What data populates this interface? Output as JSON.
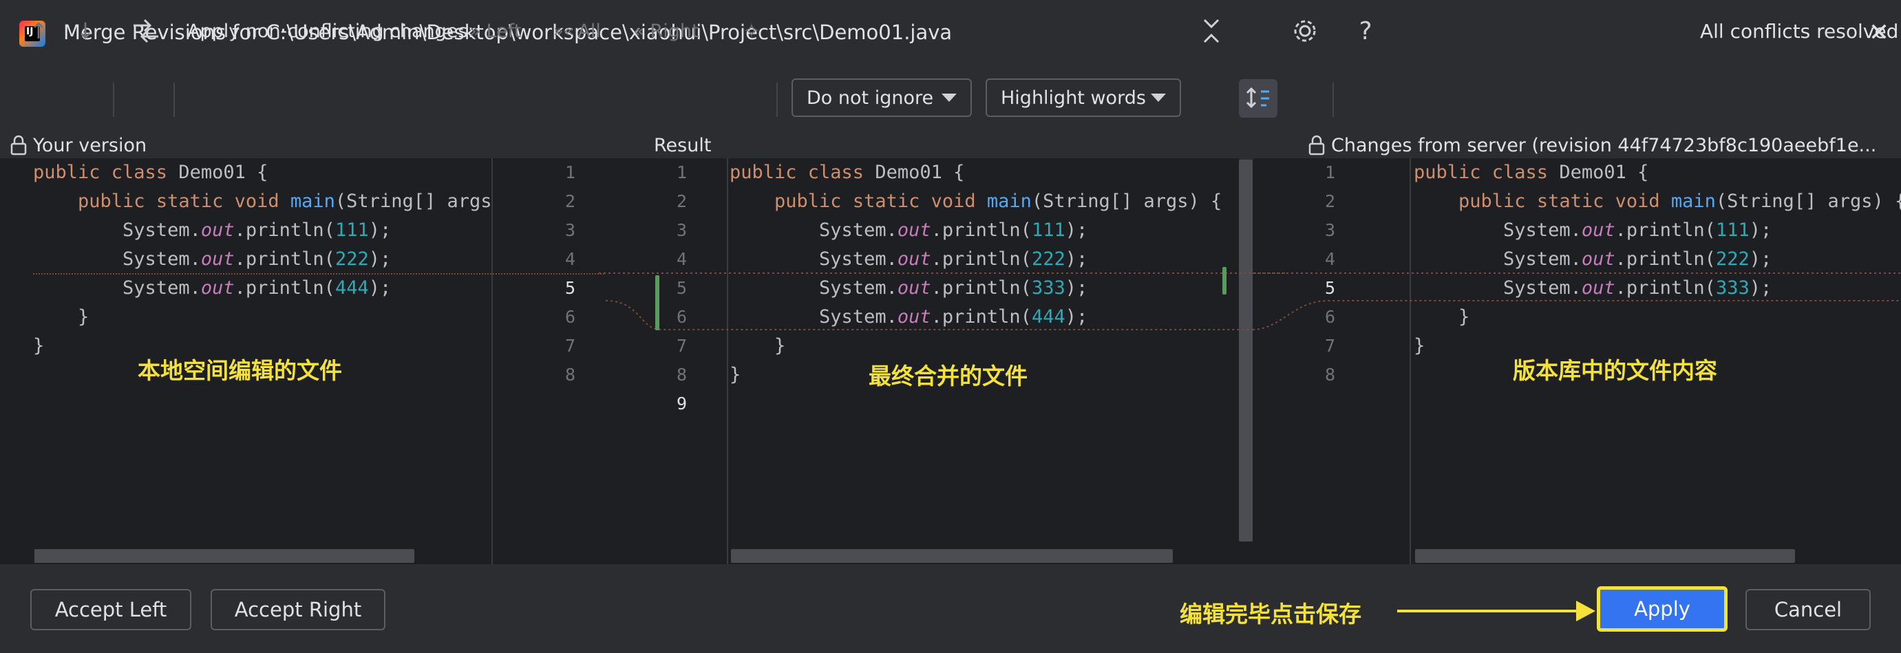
{
  "window": {
    "title": "Merge Revisions for C:\\Users\\Admin\\Desktop\\workspace\\xiaohui\\Project\\src\\Demo01.java",
    "app_icon_text": "IJ"
  },
  "toolbar": {
    "apply_label": "Apply non-conflicting changes:",
    "left_label": "Left",
    "all_label": "All",
    "right_label": "Right",
    "ignore_combo": "Do not ignore",
    "highlight_combo": "Highlight words",
    "help_label": "?",
    "status": "All conflicts resolved"
  },
  "headers": {
    "left": "Your version",
    "center": "Result",
    "right": "Changes from server (revision 44f74723bf8c190aeebf1e..."
  },
  "left_lines": [
    "1",
    "2",
    "3",
    "4",
    "5",
    "6",
    "7",
    "8"
  ],
  "center_left_lines": [
    "1",
    "2",
    "3",
    "4",
    "5",
    "6",
    "7",
    "8",
    "9"
  ],
  "center_right_lines": [
    "1",
    "2",
    "3",
    "4",
    "5",
    "6",
    "7",
    "8"
  ],
  "annotations": {
    "left": "本地空间编辑的文件",
    "center": "最终合并的文件",
    "right": "版本库中的文件内容",
    "bottom": "编辑完毕点击保存"
  },
  "buttons": {
    "accept_left": "Accept Left",
    "accept_right": "Accept Right",
    "apply": "Apply",
    "cancel": "Cancel"
  },
  "colors": {
    "accent": "#3574f0",
    "annotation": "#f4e23a",
    "keyword": "#cf8e6d",
    "function": "#56a8f5",
    "number": "#2aacb8",
    "static_field": "#c77dbb"
  }
}
